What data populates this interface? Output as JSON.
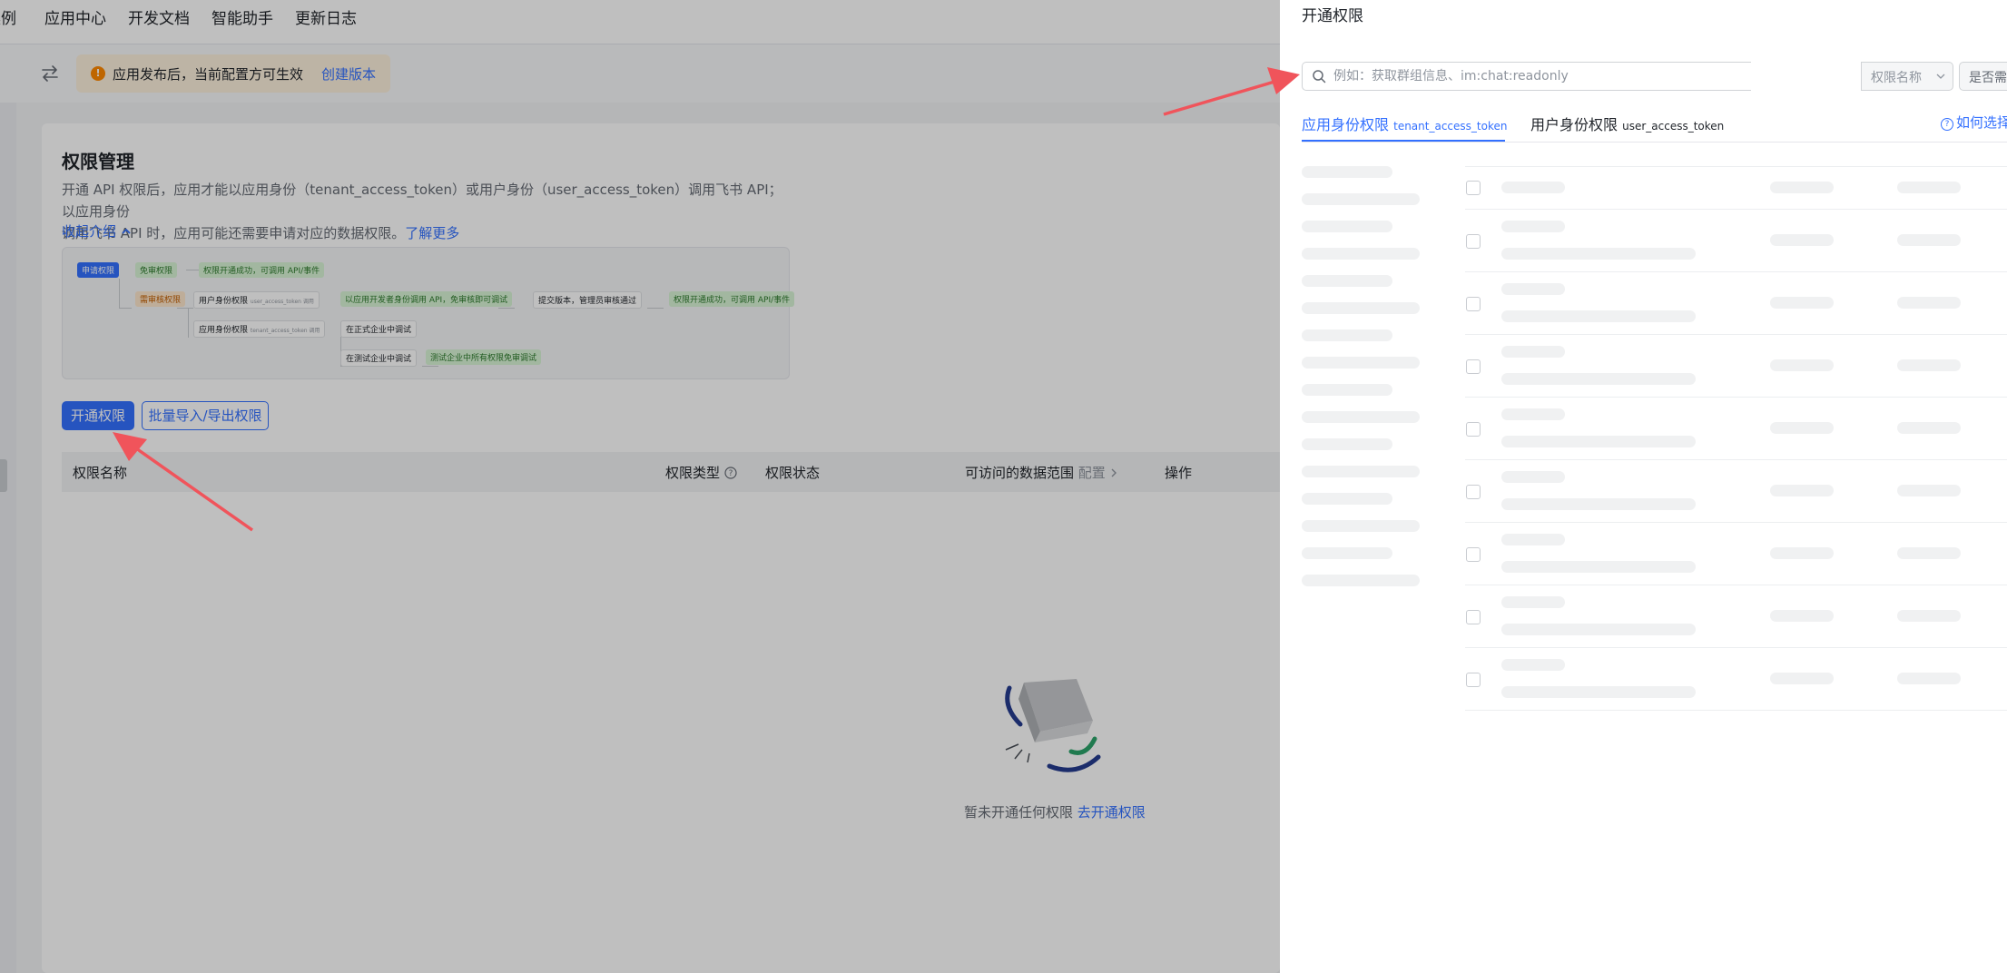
{
  "topnav": {
    "items": [
      "案例",
      "应用中心",
      "开发文档",
      "智能助手",
      "更新日志"
    ]
  },
  "notice": {
    "text": "应用发布后，当前配置方可生效",
    "link": "创建版本"
  },
  "permissions": {
    "title": "权限管理",
    "desc_line1": "开通 API 权限后，应用才能以应用身份（tenant_access_token）或用户身份（user_access_token）调用飞书 API；以应用身份",
    "desc_line2": "调用飞书 API 时，应用可能还需要申请对应的数据权限。",
    "learn_more": "了解更多",
    "collapse": "收起介绍",
    "flow": {
      "apply": "申请权限",
      "no_review": "免审权限",
      "success1": "权限开通成功，可调用 API/事件",
      "review": "需审核权限",
      "user_perm": "用户身份权限",
      "user_token": "user_access_token 调用",
      "user_debug": "以应用开发者身份调用 API，免审核即可调试",
      "submit": "提交版本，管理员审核通过",
      "success2": "权限开通成功，可调用 API/事件",
      "app_perm": "应用身份权限",
      "app_token": "tenant_access_token 调用",
      "formal": "在正式企业中调试",
      "test": "在测试企业中调试",
      "test_result": "测试企业中所有权限免审调试"
    },
    "btn_enable": "开通权限",
    "btn_batch": "批量导入/导出权限",
    "table": {
      "col_name": "权限名称",
      "col_type": "权限类型",
      "col_status": "权限状态",
      "col_scope": "可访问的数据范围",
      "col_scope_hint": "配置",
      "col_action": "操作"
    },
    "empty_text": "暂未开通任何权限",
    "empty_link": "去开通权限"
  },
  "drawer": {
    "title": "开通权限",
    "search_placeholder": "例如：获取群组信息、im:chat:readonly",
    "field_select": "权限名称",
    "filter_select": "是否需要审核",
    "tab1_label": "应用身份权限",
    "tab1_sub": "tenant_access_token",
    "tab2_label": "用户身份权限",
    "tab2_sub": "user_access_token",
    "help": "如何选择"
  },
  "colors": {
    "accent": "#3370ff",
    "notice_bg": "#fdf0dd",
    "arrow": "#f0545b"
  }
}
